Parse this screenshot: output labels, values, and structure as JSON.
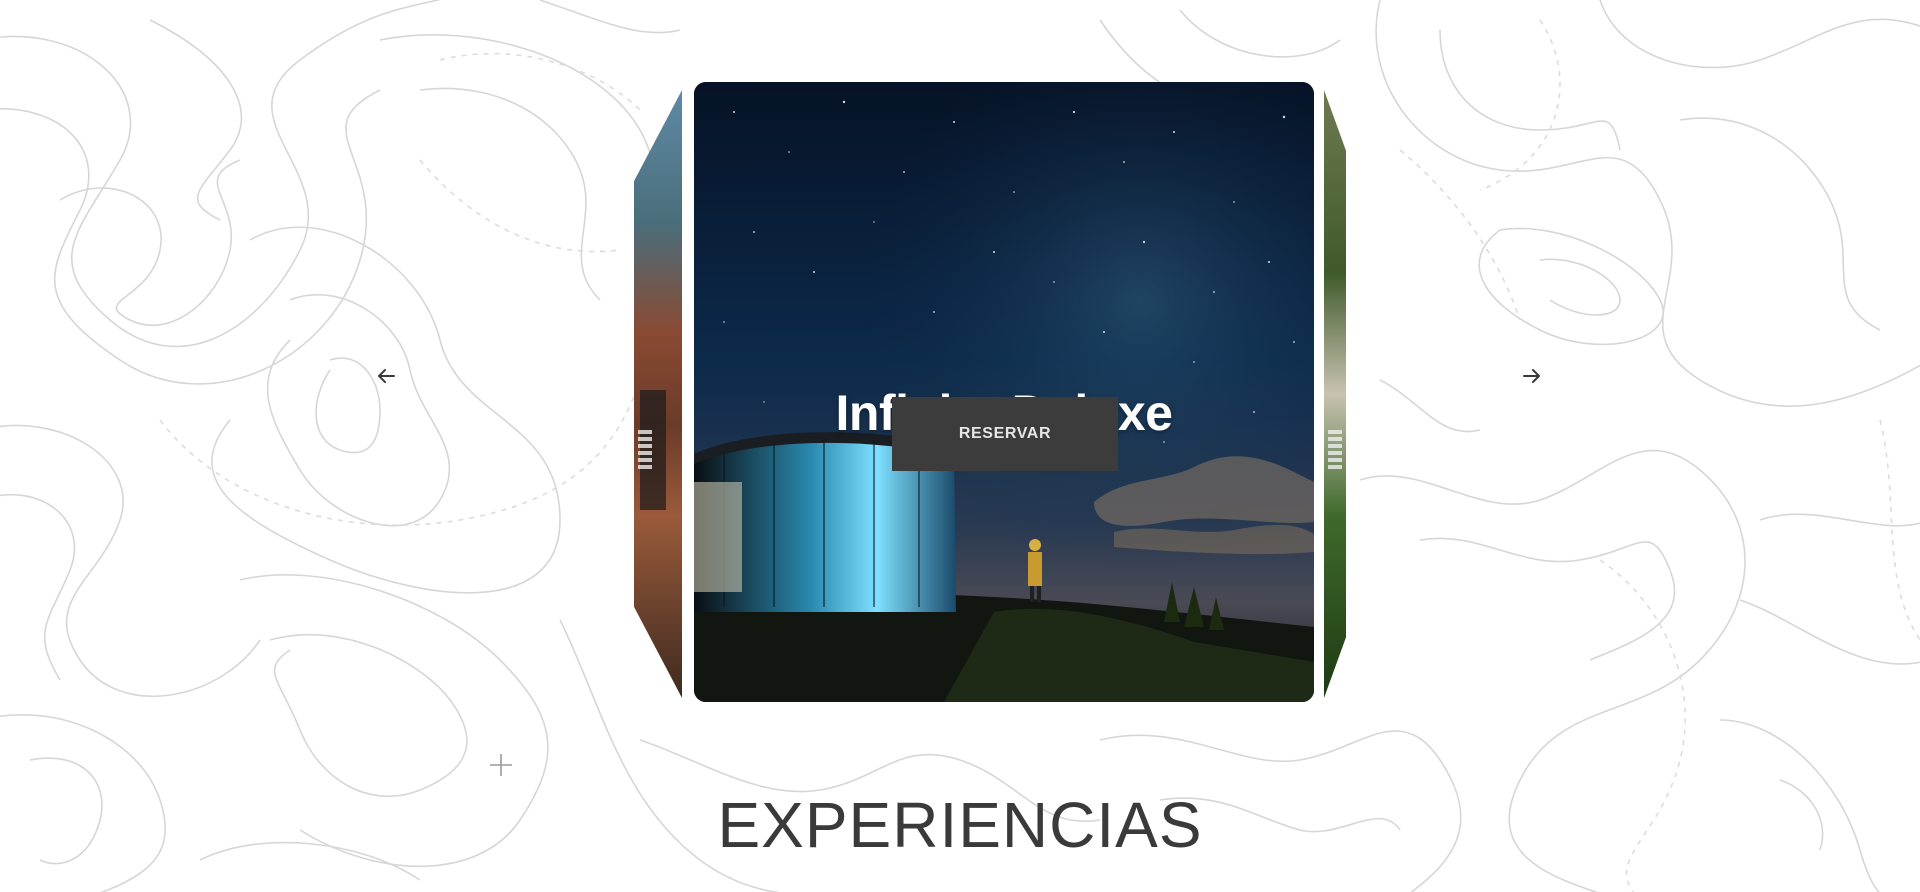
{
  "carousel": {
    "active_slide": {
      "title": "Infinito Deluxe",
      "button_label": "RESERVAR"
    },
    "prev_icon": "arrow-left-icon",
    "next_icon": "arrow-right-icon"
  },
  "section": {
    "title": "EXPERIENCIAS"
  },
  "colors": {
    "background": "#ffffff",
    "topo_lines": "#d6d6d6",
    "button_bg": "#3c3c3c",
    "button_text": "#e6e6e6",
    "heading": "#3a3a3a"
  }
}
